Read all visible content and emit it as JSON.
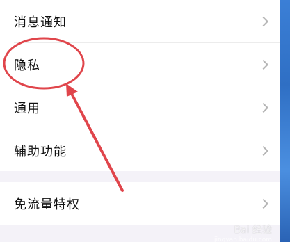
{
  "settings": {
    "rows": [
      {
        "label": "消息通知"
      },
      {
        "label": "隐私"
      },
      {
        "label": "通用"
      },
      {
        "label": "辅助功能"
      },
      {
        "label": "免流量特权"
      }
    ]
  },
  "annotation": {
    "color": "#e0454b",
    "target": "隐私",
    "shapes": [
      "ellipse-highlight",
      "arrow"
    ]
  },
  "watermark": {
    "text": "Bai 经验",
    "sub": "jingyan.baidu.com"
  },
  "colors": {
    "background": "#f4f2f8",
    "card": "#ffffff",
    "text": "#111111",
    "chevron": "#b5b5b5",
    "edge": "#3b7fd6"
  }
}
